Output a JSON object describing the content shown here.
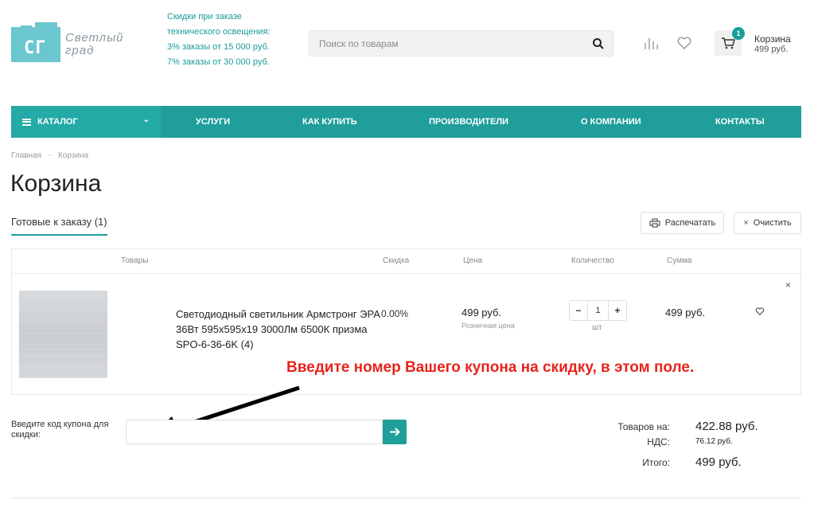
{
  "header": {
    "logo_mark": "СГ",
    "logo_text_1": "Светлый",
    "logo_text_2": "град",
    "promo": [
      "Скидки при заказе",
      "технического освещения:",
      "3% заказы от 15 000 руб.",
      "7% заказы от 30 000 руб."
    ],
    "search_placeholder": "Поиск по товарам",
    "cart_count": "1",
    "cart_title": "Корзина",
    "cart_sum": "499 руб."
  },
  "nav": {
    "catalog": "КАТАЛОГ",
    "items": [
      "УСЛУГИ",
      "КАК КУПИТЬ",
      "ПРОИЗВОДИТЕЛИ",
      "О КОМПАНИИ",
      "КОНТАКТЫ"
    ]
  },
  "breadcrumb": {
    "home": "Главная",
    "sep": "-",
    "current": "Корзина"
  },
  "page_title": "Корзина",
  "tab_ready": "Готовые к заказу (1)",
  "buttons": {
    "print": "Распечатать",
    "clear": "Очистить"
  },
  "table": {
    "headers": {
      "goods": "Товары",
      "discount": "Скидка",
      "price": "Цена",
      "quantity": "Количество",
      "sum": "Сумма"
    },
    "row": {
      "name": "Светодиодный светильник Армстронг ЭРА 36Вт 595х595х19 3000Лм 6500К призма SPO-6-36-6K (4)",
      "discount": "0.00%",
      "price": "499 руб.",
      "price_note": "Розничная цена",
      "qty_minus": "−",
      "qty": "1",
      "qty_plus": "+",
      "unit": "шт",
      "sum": "499 руб.",
      "remove": "×"
    }
  },
  "annotation": "Введите номер Вашего купона на скидку, в этом поле.",
  "coupon": {
    "label": "Введите код купона для скидки:",
    "placeholder": ""
  },
  "totals": {
    "goods_label": "Товаров на:",
    "goods_value": "422.88 руб.",
    "vat_label": "НДС:",
    "vat_value": "76.12 руб.",
    "total_label": "Итого:",
    "total_value": "499 руб."
  },
  "colors": {
    "accent": "#1f9e9b",
    "annotation": "#e8231c"
  }
}
